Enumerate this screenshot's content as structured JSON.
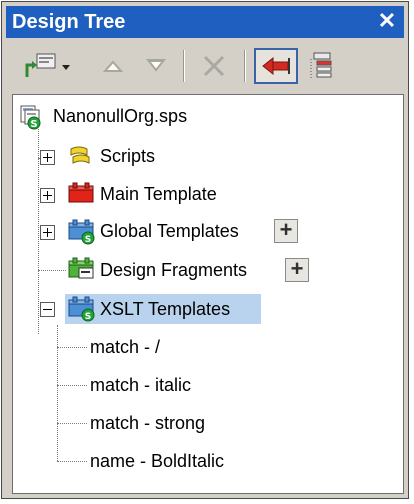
{
  "window": {
    "title": "Design Tree",
    "close_glyph": "✕"
  },
  "toolbar": {
    "buttons": [
      {
        "name": "add-component-icon"
      },
      {
        "name": "move-up-icon"
      },
      {
        "name": "move-down-icon"
      },
      {
        "name": "remove-icon"
      },
      {
        "name": "toggle-sidebar-icon",
        "active": true
      },
      {
        "name": "show-items-icon"
      }
    ]
  },
  "tree": {
    "root": {
      "label": "NanonullOrg.sps"
    },
    "items": [
      {
        "label": "Scripts",
        "expander": "plus"
      },
      {
        "label": "Main Template",
        "expander": "plus"
      },
      {
        "label": "Global Templates",
        "expander": "plus",
        "add": "+"
      },
      {
        "label": "Design Fragments",
        "add": "+"
      },
      {
        "label": "XSLT Templates",
        "expander": "minus",
        "selected": true
      }
    ],
    "children": [
      {
        "label": "match - /"
      },
      {
        "label": "match - italic"
      },
      {
        "label": "match - strong"
      },
      {
        "label": "name - BoldItalic"
      }
    ]
  },
  "colors": {
    "title_bar": "#1f5fbf",
    "selection": "#b9d3ee",
    "chrome": "#d4d0c8"
  }
}
